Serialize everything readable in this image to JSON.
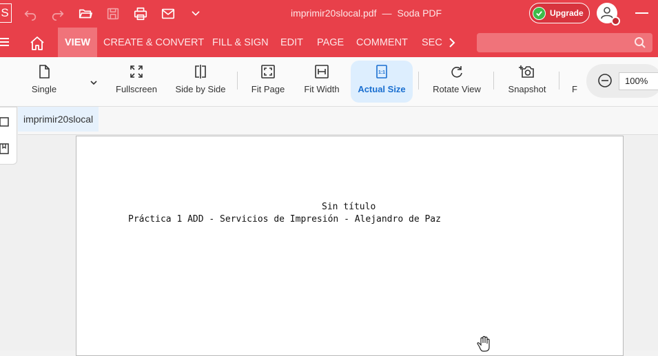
{
  "titlebar": {
    "logo_letter": "S",
    "document": "imprimir20slocal.pdf",
    "separator": "—",
    "app": "Soda PDF",
    "upgrade_label": "Upgrade"
  },
  "menu": {
    "items": [
      "VIEW",
      "CREATE & CONVERT",
      "FILL & SIGN",
      "EDIT",
      "PAGE",
      "COMMENT",
      "SEC"
    ],
    "search_placeholder": ""
  },
  "ribbon": {
    "buttons": [
      "Single",
      "Fullscreen",
      "Side by Side",
      "Fit Page",
      "Fit Width",
      "Actual Size",
      "Rotate View",
      "Snapshot",
      "F"
    ],
    "zoom": "100%"
  },
  "tabs": [
    "imprimir20slocal"
  ],
  "page": {
    "title": "Sin título",
    "subtitle": "Práctica 1 ADD - Servicios de Impresión - Alejandro de Paz"
  },
  "colors": {
    "brand": "#e8404a",
    "active_tab": "#f0737a",
    "accent_blue": "#1a6fd0",
    "upgrade_check": "#3dbb4a"
  }
}
